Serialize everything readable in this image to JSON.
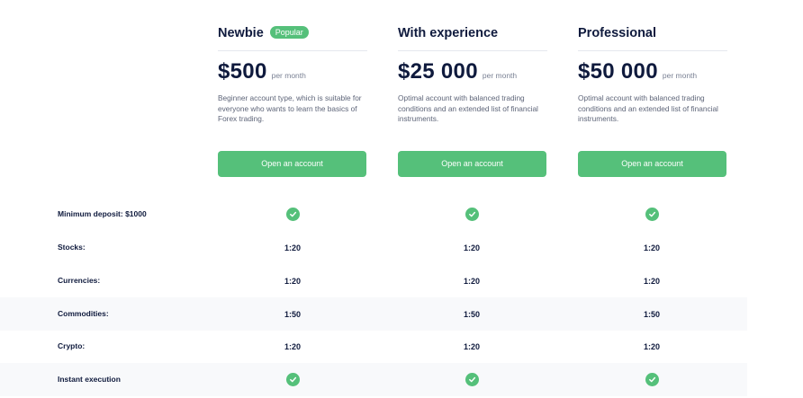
{
  "plans": [
    {
      "name": "Newbie",
      "badge": "Popular",
      "price": "$500",
      "period": "per month",
      "description": "Beginner account type, which is suitable for everyone who wants to learn the basics of Forex trading.",
      "button_label": "Open an account"
    },
    {
      "name": "With experience",
      "badge": "",
      "price": "$25 000",
      "period": "per month",
      "description": "Optimal account with balanced trading conditions and an extended list of financial instruments.",
      "button_label": "Open an account"
    },
    {
      "name": "Professional",
      "badge": "",
      "price": "$50 000",
      "period": "per month",
      "description": "Optimal account with balanced trading conditions and an extended list of financial instruments.",
      "button_label": "Open an account"
    }
  ],
  "features": [
    {
      "label": "Minimum deposit: $1000",
      "values": [
        "check",
        "check",
        "check"
      ]
    },
    {
      "label": "Stocks:",
      "values": [
        "1:20",
        "1:20",
        "1:20"
      ]
    },
    {
      "label": "Currencies:",
      "values": [
        "1:20",
        "1:20",
        "1:20"
      ]
    },
    {
      "label": "Commodities:",
      "values": [
        "1:50",
        "1:50",
        "1:50"
      ]
    },
    {
      "label": "Crypto:",
      "values": [
        "1:20",
        "1:20",
        "1:20"
      ]
    },
    {
      "label": "Instant execution",
      "values": [
        "check",
        "check",
        "check"
      ]
    }
  ],
  "colors": {
    "accent": "#55c07a",
    "text_dark": "#0f1a3d",
    "text_muted": "#5d6478",
    "row_shade": "#f8f9fb"
  },
  "icons": {
    "included": "check-circle-icon"
  }
}
